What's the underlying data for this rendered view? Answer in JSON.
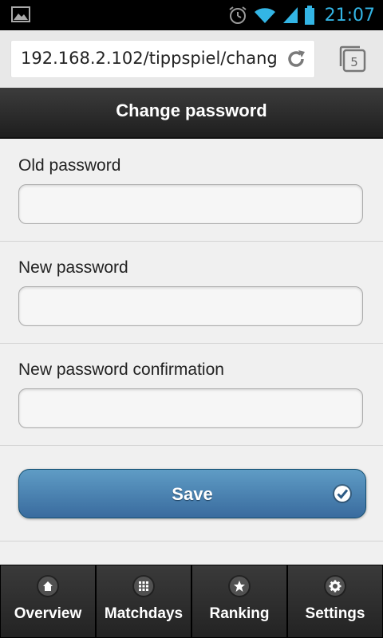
{
  "status_bar": {
    "time": "21:07",
    "icons": [
      "image-notification-icon",
      "alarm-icon",
      "wifi-icon",
      "signal-icon",
      "battery-icon"
    ],
    "accent_color": "#33b5e5"
  },
  "browser": {
    "url": "192.168.2.102/tippspiel/chang",
    "tab_count": "5",
    "icons": [
      "reload-icon",
      "tabs-icon"
    ]
  },
  "header": {
    "title": "Change password"
  },
  "form": {
    "old_password": {
      "label": "Old password",
      "value": ""
    },
    "new_password": {
      "label": "New password",
      "value": ""
    },
    "new_password_confirmation": {
      "label": "New password confirmation",
      "value": ""
    },
    "save_label": "Save",
    "save_icon": "check-icon"
  },
  "navbar": {
    "items": [
      {
        "label": "Overview",
        "icon": "home-icon"
      },
      {
        "label": "Matchdays",
        "icon": "grid-icon"
      },
      {
        "label": "Ranking",
        "icon": "star-icon"
      },
      {
        "label": "Settings",
        "icon": "gear-icon"
      }
    ]
  },
  "colors": {
    "header_bg": "#2a2a2a",
    "button_blue": "#4a80b0",
    "navbar_bg": "#2b2b2b"
  }
}
